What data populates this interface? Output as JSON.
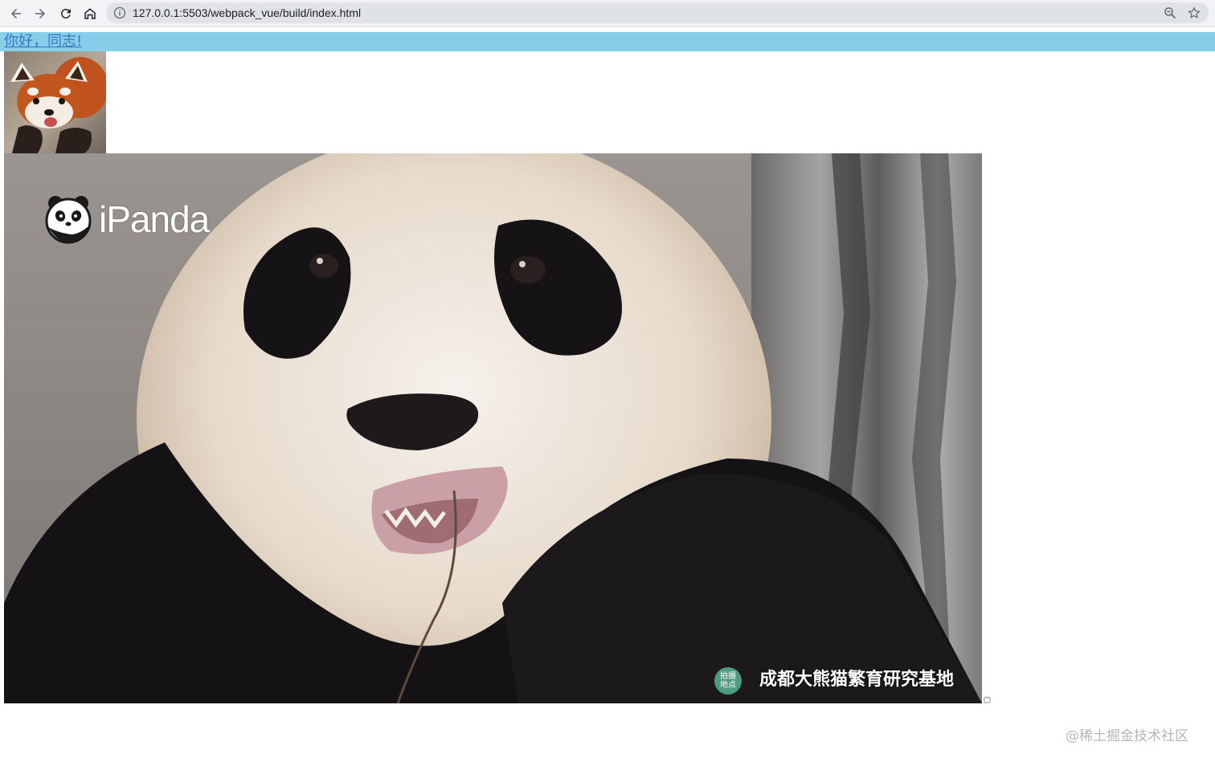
{
  "browser": {
    "url": "127.0.0.1:5503/webpack_vue/build/index.html",
    "icons": {
      "back": "arrow-left-icon",
      "forward": "arrow-right-icon",
      "reload": "reload-icon",
      "home": "home-icon",
      "site_info": "info-circle-icon",
      "zoom": "magnifier-minus-icon",
      "bookmark": "star-icon"
    }
  },
  "page": {
    "greeting": "你好，同志!",
    "greeting_bar_color": "#87ceeb",
    "greeting_text_color": "#3a78c0",
    "small_image": "red panda photo",
    "large_image": {
      "subject": "giant panda photo",
      "logo_text": "iPanda",
      "badge_text": "拍摄\n地点",
      "badge_line1": "拍摄",
      "badge_line2": "地点",
      "location": "成都大熊猫繁育研究基地",
      "badge_color": "#4d9b80"
    }
  },
  "watermark": "@稀土掘金技术社区"
}
